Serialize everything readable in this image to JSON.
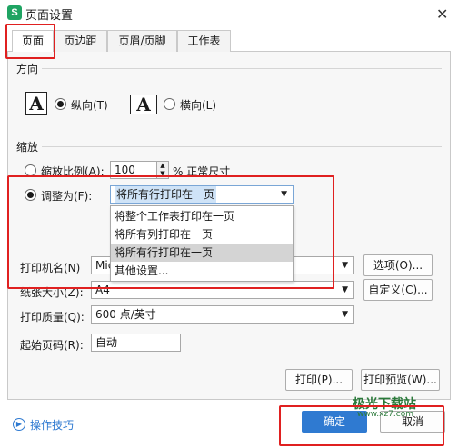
{
  "window": {
    "title": "页面设置",
    "app_icon": "S"
  },
  "tabs": [
    {
      "label": "页面"
    },
    {
      "label": "页边距"
    },
    {
      "label": "页眉/页脚"
    },
    {
      "label": "工作表"
    }
  ],
  "orientation": {
    "label": "方向",
    "icon_glyph": "A",
    "portrait": "纵向(T)",
    "landscape": "横向(L)",
    "selected": "portrait"
  },
  "scaling": {
    "label": "缩放",
    "ratio_label": "缩放比例(A):",
    "ratio_value": "100",
    "ratio_suffix": "% 正常尺寸",
    "fit_label": "调整为(F):",
    "fit_value": "将所有行打印在一页",
    "selected": "fit"
  },
  "dropdown": {
    "items": [
      "将整个工作表打印在一页",
      "将所有列打印在一页",
      "将所有行打印在一页",
      "其他设置..."
    ],
    "highlighted_index": 2
  },
  "printer": {
    "name_label": "打印机名(N)",
    "name_value": "Mic",
    "options_button": "选项(O)...",
    "paper_label": "纸张大小(Z):",
    "paper_value": "A4",
    "custom_button": "自定义(C)...",
    "quality_label": "打印质量(Q):",
    "quality_value": "600 点/英寸",
    "start_page_label": "起始页码(R):",
    "start_page_value": "自动"
  },
  "actions": {
    "print": "打印(P)...",
    "preview": "打印预览(W)...",
    "ok": "确定",
    "cancel": "取消",
    "tips": "操作技巧"
  },
  "watermark": {
    "name": "极光下载站",
    "url": "www.xz7.com"
  },
  "colors": {
    "accent": "#2f7ad1",
    "highlight_box": "#e02020",
    "dropdown_selected": "#d4d4d4"
  }
}
